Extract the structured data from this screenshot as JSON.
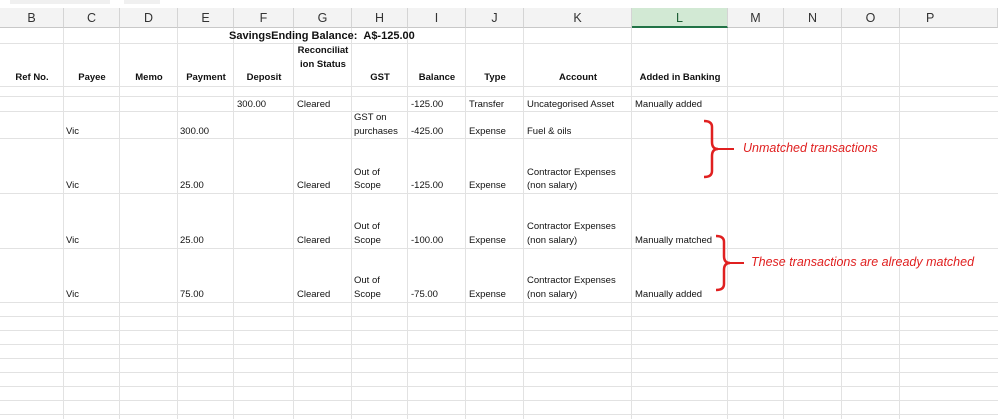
{
  "columns": [
    "B",
    "C",
    "D",
    "E",
    "F",
    "G",
    "H",
    "I",
    "J",
    "K",
    "L",
    "M",
    "N",
    "O",
    "P"
  ],
  "balance": {
    "label": "SavingsEnding Balance:",
    "amount": "A$-125.00"
  },
  "headers": {
    "ref_no": "Ref No.",
    "payee": "Payee",
    "memo": "Memo",
    "payment": "Payment",
    "deposit": "Deposit",
    "reconciliation_status": [
      "Reconciliat",
      "ion Status"
    ],
    "gst": "GST",
    "balance": "Balance",
    "type": "Type",
    "account": "Account",
    "added_in_banking": "Added in Banking"
  },
  "rows": [
    {
      "payee": "",
      "payment": "",
      "deposit": "300.00",
      "status": "Cleared",
      "gst": [
        ""
      ],
      "balance": "-125.00",
      "type": "Transfer",
      "account": [
        "Uncategorised Asset"
      ],
      "added": "Manually added"
    },
    {
      "payee": "Vic",
      "payment": "300.00",
      "deposit": "",
      "status": "",
      "gst": [
        "GST on",
        "purchases"
      ],
      "balance": "-425.00",
      "type": "Expense",
      "account": [
        "Fuel & oils"
      ],
      "added": ""
    },
    {
      "payee": "Vic",
      "payment": "25.00",
      "deposit": "",
      "status": "Cleared",
      "gst": [
        "Out of",
        "Scope"
      ],
      "balance": "-125.00",
      "type": "Expense",
      "account": [
        "Contractor Expenses",
        "(non salary)"
      ],
      "added": ""
    },
    {
      "payee": "Vic",
      "payment": "25.00",
      "deposit": "",
      "status": "Cleared",
      "gst": [
        "Out of",
        "Scope"
      ],
      "balance": "-100.00",
      "type": "Expense",
      "account": [
        "Contractor Expenses",
        "(non salary)"
      ],
      "added": "Manually matched"
    },
    {
      "payee": "Vic",
      "payment": "75.00",
      "deposit": "",
      "status": "Cleared",
      "gst": [
        "Out of",
        "Scope"
      ],
      "balance": "-75.00",
      "type": "Expense",
      "account": [
        "Contractor Expenses",
        "(non salary)"
      ],
      "added": "Manually added"
    }
  ],
  "annotations": {
    "unmatched": "Unmatched transactions",
    "matched": "These transactions are already matched",
    "color": "#e02020"
  },
  "selected_column": "L"
}
